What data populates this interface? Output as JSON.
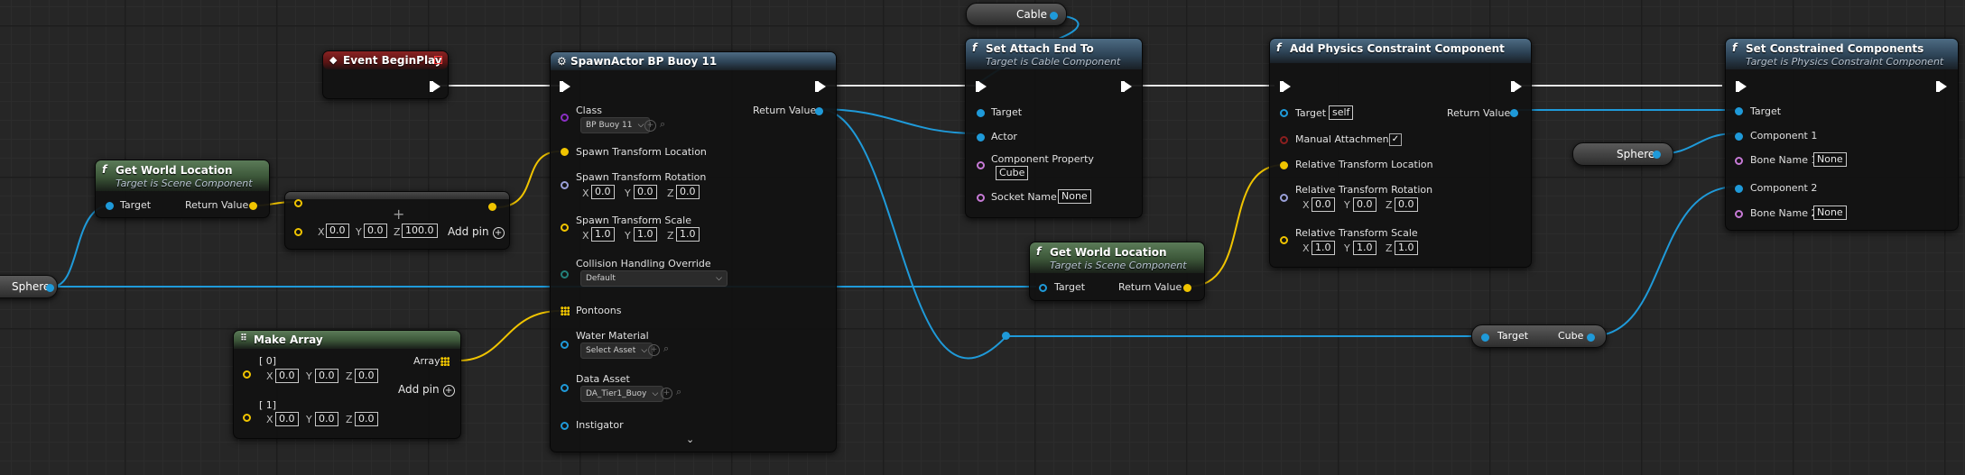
{
  "colors": {
    "object_wire": "#1f9ad9",
    "vector_wire": "#f0c400",
    "exec_wire": "#ffffff",
    "event_header": "#8a2222",
    "function_header": "#4d6b83",
    "pure_header": "#5b7b58"
  },
  "event_begin_play": {
    "title": "Event BeginPlay",
    "icon": "diamond-event-icon"
  },
  "spawn_actor": {
    "title": "SpawnActor BP Buoy 11",
    "class_label": "Class",
    "class_value": "BP Buoy 11",
    "return_label": "Return Value",
    "spawn_location": "Spawn Transform Location",
    "spawn_rotation": "Spawn Transform Rotation",
    "rot": {
      "x": "0.0",
      "y": "0.0",
      "z": "0.0"
    },
    "spawn_scale": "Spawn Transform Scale",
    "scale": {
      "x": "1.0",
      "y": "1.0",
      "z": "1.0"
    },
    "collision_label": "Collision Handling Override",
    "collision_value": "Default",
    "pontoons": "Pontoons",
    "water_material": "Water Material",
    "water_material_value": "Select Asset",
    "data_asset": "Data Asset",
    "data_asset_value": "DA_Tier1_Buoy",
    "instigator": "Instigator"
  },
  "gwl1": {
    "title": "Get World Location",
    "subtitle": "Target is Scene Component",
    "target": "Target",
    "return_label": "Return Value"
  },
  "add_vec": {
    "x": "0.0",
    "y": "0.0",
    "z": "100.0",
    "add_pin": "Add pin",
    "op": "+"
  },
  "sphere_left": {
    "label": "Sphere"
  },
  "make_array": {
    "title": "Make Array",
    "array_label": "Array",
    "add_pin": "Add pin",
    "items": [
      {
        "label": "[ 0]",
        "x": "0.0",
        "y": "0.0",
        "z": "0.0"
      },
      {
        "label": "[ 1]",
        "x": "0.0",
        "y": "0.0",
        "z": "0.0"
      }
    ]
  },
  "cable": {
    "label": "Cable"
  },
  "set_attach": {
    "title": "Set Attach End To",
    "subtitle": "Target is Cable Component",
    "target": "Target",
    "actor": "Actor",
    "component_property": "Component Property",
    "component_property_value": "Cube",
    "socket_name": "Socket Name",
    "socket_value": "None"
  },
  "gwl2": {
    "title": "Get World Location",
    "subtitle": "Target is Scene Component",
    "target": "Target",
    "return_label": "Return Value"
  },
  "add_constraint": {
    "title": "Add Physics Constraint Component",
    "target": "Target",
    "target_value": "self",
    "return_label": "Return Value",
    "manual": "Manual Attachment",
    "manual_check": "✓",
    "rel_loc": "Relative Transform Location",
    "rel_rot": "Relative Transform Rotation",
    "rot": {
      "x": "0.0",
      "y": "0.0",
      "z": "0.0"
    },
    "rel_scale": "Relative Transform Scale",
    "scale": {
      "x": "1.0",
      "y": "1.0",
      "z": "1.0"
    }
  },
  "cube_getter": {
    "target": "Target",
    "cube": "Cube"
  },
  "sphere_right": {
    "label": "Sphere"
  },
  "set_constrained": {
    "title": "Set Constrained Components",
    "subtitle": "Target is Physics Constraint Component",
    "target": "Target",
    "comp1": "Component 1",
    "bone1": "Bone Name 1",
    "bone1_value": "None",
    "comp2": "Component 2",
    "bone2": "Bone Name 2",
    "bone2_value": "None"
  },
  "axis": {
    "x": "X",
    "y": "Y",
    "z": "Z"
  }
}
